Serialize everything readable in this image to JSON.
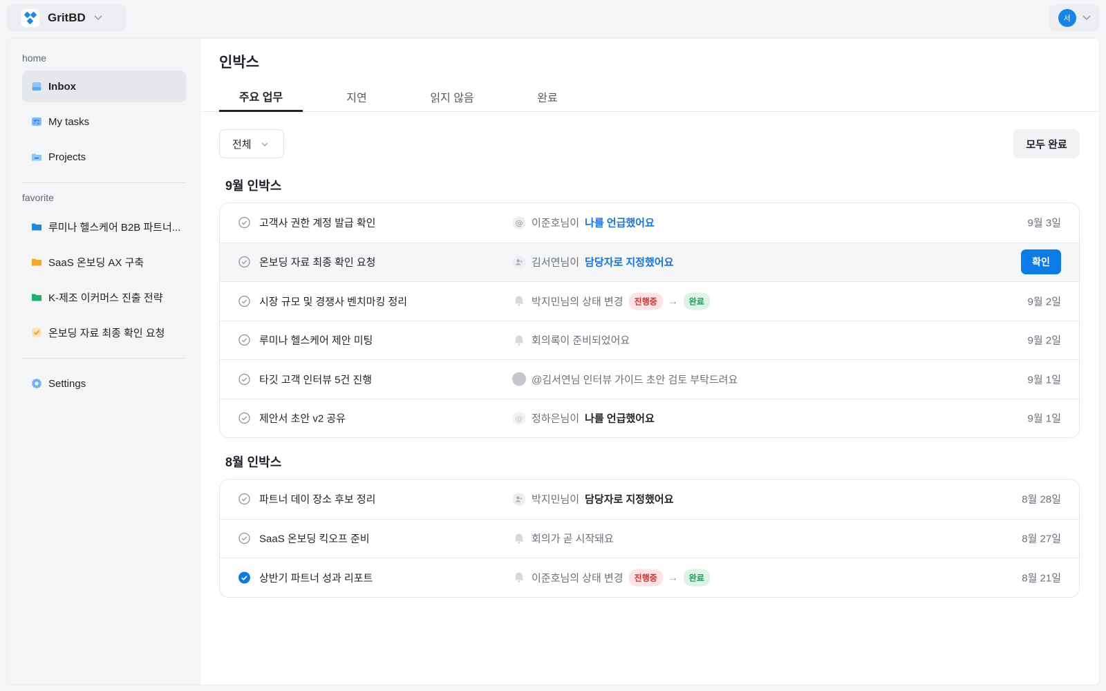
{
  "workspace": {
    "name": "GritBD"
  },
  "account": {
    "avatar_initial": "서"
  },
  "sidebar": {
    "home_label": "home",
    "home_items": [
      {
        "label": "Inbox",
        "icon": "inbox-icon",
        "active": true
      },
      {
        "label": "My tasks",
        "icon": "tasks-icon"
      },
      {
        "label": "Projects",
        "icon": "folder-icon"
      }
    ],
    "favorite_label": "favorite",
    "favorite_items": [
      {
        "label": "루미나 헬스케어 B2B 파트너...",
        "icon": "folder-icon",
        "color": "#1e88e5"
      },
      {
        "label": "SaaS 온보딩 AX 구축",
        "icon": "folder-icon",
        "color": "#f6a623"
      },
      {
        "label": "K-제조 이커머스 진출 전략",
        "icon": "folder-icon",
        "color": "#19b36b"
      },
      {
        "label": "온보딩 자료 최종 확인 요청",
        "icon": "task-check-icon",
        "color": "#f6a623"
      }
    ],
    "settings_label": "Settings"
  },
  "main": {
    "title": "인박스",
    "tabs": [
      "주요 업무",
      "지연",
      "읽지 않음",
      "완료"
    ],
    "active_tab": "주요 업무",
    "filter": {
      "value": "전체"
    },
    "complete_all_label": "모두 완료"
  },
  "groups": [
    {
      "title": "9월 인박스",
      "items": [
        {
          "task": "고객사 권한 계정 발급 확인",
          "icon": "mention-icon",
          "actor": "이준호님이",
          "highlight": "나를 언급했어요",
          "hl": "blue",
          "date": "9월 3일"
        },
        {
          "task": "온보딩 자료 최종 확인 요청",
          "icon": "assign-icon",
          "actor": "김서연님이",
          "highlight": "담당자로 지정했어요",
          "hl": "blue",
          "action_label": "확인"
        },
        {
          "task": "시장 규모 및 경쟁사 벤치마킹 정리",
          "icon": "bell-icon",
          "actor": "박지민님의 상태 변경",
          "from": "진행중",
          "to": "완료",
          "date": "9월 2일"
        },
        {
          "task": "루미나 헬스케어 제안 미팅",
          "icon": "bell-icon",
          "actor": "회의록이 준비되었어요",
          "date": "9월 2일"
        },
        {
          "task": "타깃 고객 인터뷰 5건 진행",
          "icon": "user-avatar-icon",
          "actor": "@김서연님 인터뷰 가이드 초안 검토 부탁드려요",
          "date": "9월 1일"
        },
        {
          "task": "제안서 초안 v2 공유",
          "icon": "mention-icon",
          "actor": "정하은님이",
          "highlight": "나를 언급했어요",
          "hl": "dark",
          "date": "9월 1일"
        }
      ]
    },
    {
      "title": "8월 인박스",
      "items": [
        {
          "task": "파트너 데이 장소 후보 정리",
          "icon": "assign-icon",
          "actor": "박지민님이",
          "highlight": "담당자로 지정했어요",
          "hl": "dark",
          "date": "8월 28일"
        },
        {
          "task": "SaaS 온보딩 킥오프 준비",
          "icon": "bell-icon",
          "actor": "회의가 곧 시작돼요",
          "date": "8월 27일"
        },
        {
          "task": "상반기 파트너 성과 리포트",
          "icon": "bell-icon",
          "actor": "이준호님의 상태 변경",
          "from": "진행중",
          "to": "완료",
          "date": "8월 21일",
          "checked": true
        }
      ]
    }
  ]
}
